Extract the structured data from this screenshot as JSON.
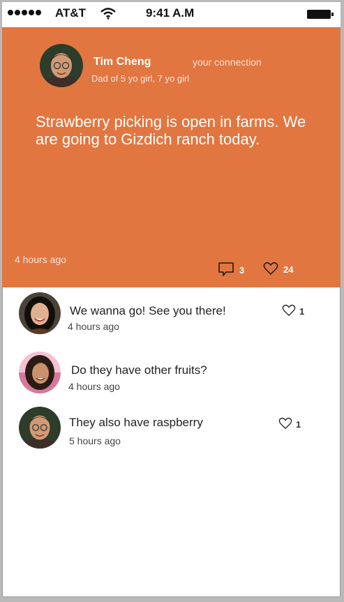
{
  "status_bar": {
    "carrier": "AT&T",
    "time": "9:41 A.M"
  },
  "post": {
    "author_name": "Tim Cheng",
    "relationship": "your  connection",
    "author_bio": "Dad of 5 yo girl, 7 yo girl",
    "text": "Strawberry picking is open in farms. We are going to Gizdich ranch today.",
    "time": "4 hours ago",
    "comment_count": "3",
    "like_count": "24"
  },
  "comments": [
    {
      "text": "We wanna go!  See you there!",
      "time": "4 hours ago",
      "likes": "1"
    },
    {
      "text": "Do they have other fruits?",
      "time": "4 hours ago",
      "likes": ""
    },
    {
      "text": "They also have raspberry",
      "time": "5 hours ago",
      "likes": "1"
    }
  ],
  "colors": {
    "accent": "#e27640",
    "background": "#ffffff"
  },
  "icons": [
    "wifi-icon",
    "battery-icon",
    "comment-icon",
    "heart-icon"
  ]
}
